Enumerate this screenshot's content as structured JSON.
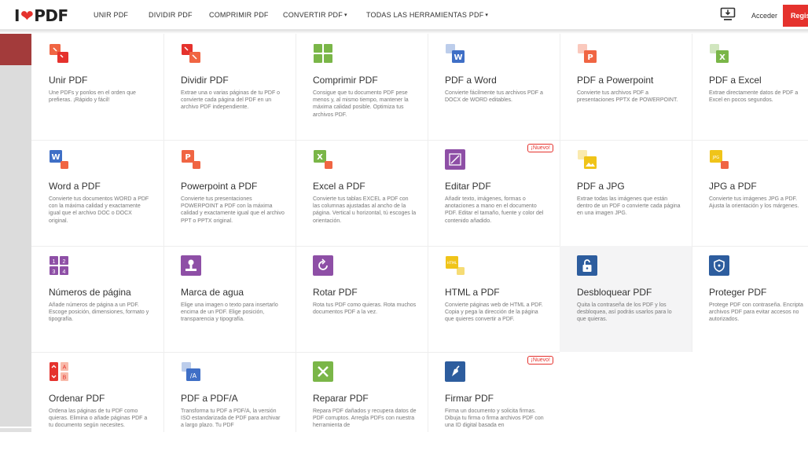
{
  "header": {
    "logo_prefix": "I",
    "logo_heart": "❤",
    "logo_suffix": "PDF",
    "nav": [
      {
        "label": "UNIR PDF",
        "dropdown": false
      },
      {
        "label": "DIVIDIR PDF",
        "dropdown": false
      },
      {
        "label": "COMPRIMIR PDF",
        "dropdown": false
      },
      {
        "label": "CONVERTIR PDF",
        "dropdown": true
      },
      {
        "label": "TODAS LAS HERRAMIENTAS PDF",
        "dropdown": true
      }
    ],
    "caret": "▾",
    "login": "Acceder",
    "signup": "Regis",
    "download_icon": "desktop-download-icon"
  },
  "badge_label": "¡Nuevo!",
  "colors": {
    "brand": "#e5322d",
    "orange": "#f06543",
    "green": "#7ab648",
    "blue": "#3f6fc6",
    "purple": "#8e4fa6",
    "yellow": "#f0c419",
    "navy": "#2d5d9e"
  },
  "tools": [
    {
      "title": "Unir PDF",
      "desc": "Une PDFs y ponlos en el orden que prefieras. ¡Rápido y fácil!",
      "icon": "merge-icon"
    },
    {
      "title": "Dividir PDF",
      "desc": "Extrae una o varias páginas de tu PDF o convierte cada página del PDF en un archivo PDF independiente.",
      "icon": "split-icon"
    },
    {
      "title": "Comprimir PDF",
      "desc": "Consigue que tu documento PDF pese menos y, al mismo tiempo, mantener la máxima calidad posible. Optimiza tus archivos PDF.",
      "icon": "compress-icon"
    },
    {
      "title": "PDF a Word",
      "desc": "Convierte fácilmente tus archivos PDF a DOCX de WORD editables.",
      "icon": "pdf-to-word-icon"
    },
    {
      "title": "PDF a Powerpoint",
      "desc": "Convierte tus archivos PDF a presentaciones PPTX de POWERPOINT.",
      "icon": "pdf-to-powerpoint-icon"
    },
    {
      "title": "PDF a Excel",
      "desc": "Extrae directamente datos de PDF a Excel en pocos segundos.",
      "icon": "pdf-to-excel-icon"
    },
    {
      "title": "Word a PDF",
      "desc": "Convierte tus documentos WORD a PDF con la máxima calidad y exactamente igual que el archivo DOC o DOCX original.",
      "icon": "word-to-pdf-icon"
    },
    {
      "title": "Powerpoint a PDF",
      "desc": "Convierte tus presentaciones POWERPOINT a PDF con la máxima calidad y exactamente igual que el archivo PPT o PPTX original.",
      "icon": "powerpoint-to-pdf-icon"
    },
    {
      "title": "Excel a PDF",
      "desc": "Convierte tus tablas EXCEL a PDF con las columnas ajustadas al ancho de la página. Vertical u horizontal, tú escoges la orientación.",
      "icon": "excel-to-pdf-icon"
    },
    {
      "title": "Editar PDF",
      "desc": "Añadir texto, imágenes, formas o anotaciones a mano en el documento PDF. Editar el tamaño, fuente y color del contenido añadido.",
      "icon": "edit-pdf-icon",
      "badge": true
    },
    {
      "title": "PDF a JPG",
      "desc": "Extrae todas las imágenes que están dentro de un PDF o convierte cada página en una imagen JPG.",
      "icon": "pdf-to-jpg-icon"
    },
    {
      "title": "JPG a PDF",
      "desc": "Convierte tus imágenes JPG a PDF. Ajusta la orientación y los márgenes.",
      "icon": "jpg-to-pdf-icon"
    },
    {
      "title": "Números de página",
      "desc": "Añade números de página a un PDF. Escoge posición, dimensiones, formato y tipografía.",
      "icon": "page-numbers-icon"
    },
    {
      "title": "Marca de agua",
      "desc": "Elige una imagen o texto para insertarlo encima de un PDF. Elige posición, transparencia y tipografía.",
      "icon": "watermark-stamp-icon"
    },
    {
      "title": "Rotar PDF",
      "desc": "Rota tus PDF como quieras. Rota muchos documentos PDF a la vez.",
      "icon": "rotate-icon"
    },
    {
      "title": "HTML a PDF",
      "desc": "Convierte páginas web de HTML a PDF. Copia y pega la dirección de la página que quieres convertir a PDF.",
      "icon": "html-to-pdf-icon"
    },
    {
      "title": "Desbloquear PDF",
      "desc": "Quita la contraseña de los PDF y los desbloquea, así podrás usarlos para lo que quieras.",
      "icon": "unlock-icon",
      "hover": true
    },
    {
      "title": "Proteger PDF",
      "desc": "Protege PDF con contraseña. Encripta archivos PDF para evitar accesos no autorizados.",
      "icon": "shield-icon"
    },
    {
      "title": "Ordenar PDF",
      "desc": "Ordena las páginas de tu PDF como quieras. Elimina o añade páginas PDF a tu documento según necesites.",
      "icon": "organize-icon"
    },
    {
      "title": "PDF a PDF/A",
      "desc": "Transforma tu PDF a PDF/A, la versión ISO estandarizada de PDF para archivar a largo plazo. Tu PDF",
      "icon": "pdf-to-pdfa-icon"
    },
    {
      "title": "Reparar PDF",
      "desc": "Repara PDF dañados y recupera datos de PDF corruptos. Arregla PDFs con nuestra herramienta de",
      "icon": "repair-icon"
    },
    {
      "title": "Firmar PDF",
      "desc": "Firma un documento y solicita firmas. Dibuja tu firma o firma archivos PDF con una ID digital basada en",
      "icon": "sign-icon",
      "badge": true
    }
  ]
}
